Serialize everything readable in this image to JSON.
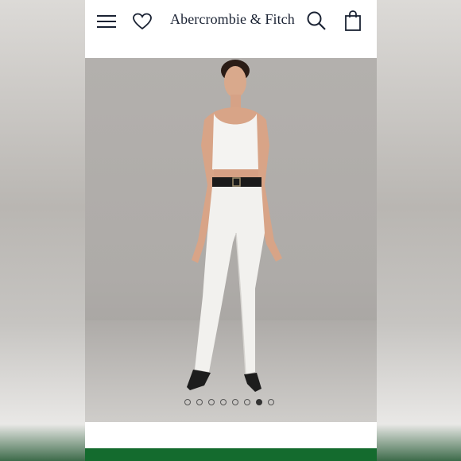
{
  "app": {
    "logo": "Abercrombie & Fitch"
  },
  "header": {
    "icons": [
      "menu-icon",
      "heart-icon",
      "search-icon",
      "shopping-bag-icon"
    ]
  },
  "carousel": {
    "total_slides": 8,
    "active_index": 6
  },
  "colors": {
    "brand_navy": "#1a2233",
    "cta_green": "#146b2e",
    "image_bg": "#b1aeab"
  }
}
